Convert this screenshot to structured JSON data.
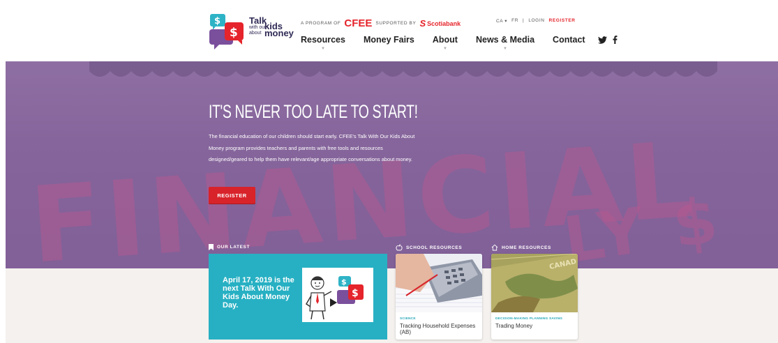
{
  "logo": {
    "line1": "Talk",
    "line2": "with our",
    "line3": "kids",
    "line4": "about",
    "line5": "money",
    "dollar": "$"
  },
  "program": {
    "prefix": "A PROGRAM OF",
    "cfee": "CFEE",
    "supported": "SUPPORTED BY",
    "sponsor": "Scotiabank"
  },
  "utility": {
    "region": "CA ▾",
    "language": "FR",
    "separator": "|",
    "login": "LOGIN",
    "register": "REGISTER"
  },
  "nav": {
    "items": [
      {
        "label": "Resources",
        "caret": "▼"
      },
      {
        "label": "Money Fairs",
        "caret": ""
      },
      {
        "label": "About",
        "caret": "▼"
      },
      {
        "label": "News & Media",
        "caret": "▼"
      },
      {
        "label": "Contact",
        "caret": ""
      }
    ]
  },
  "hero": {
    "title": "IT'S NEVER TOO LATE TO START!",
    "body": "The financial education of our children should start early. CFEE's Talk With Our Kids About Money program provides teachers and parents with free tools and resources designed/geared to help them have relevant/age appropriate conversations about money.",
    "cta": "REGISTER",
    "background_word_1": "FINANCIAL",
    "background_word_2": "LY $"
  },
  "sections": {
    "latest": "OUR LATEST",
    "school": "SCHOOL RESOURCES",
    "home": "HOME RESOURCES"
  },
  "latest_card": {
    "text": "April 17, 2019 is the next Talk With Our Kids About Money Day."
  },
  "resources": [
    {
      "tag": "SCIENCE",
      "title": "Tracking Household Expenses (AB)"
    },
    {
      "tag": "DECISION-MAKING PLANNING SAVING",
      "title": "Trading Money"
    }
  ],
  "colors": {
    "accent_red": "#e5242b",
    "teal": "#27b0c3",
    "hero_purple": "#8d6d9f",
    "band": "#f4f1ee"
  }
}
